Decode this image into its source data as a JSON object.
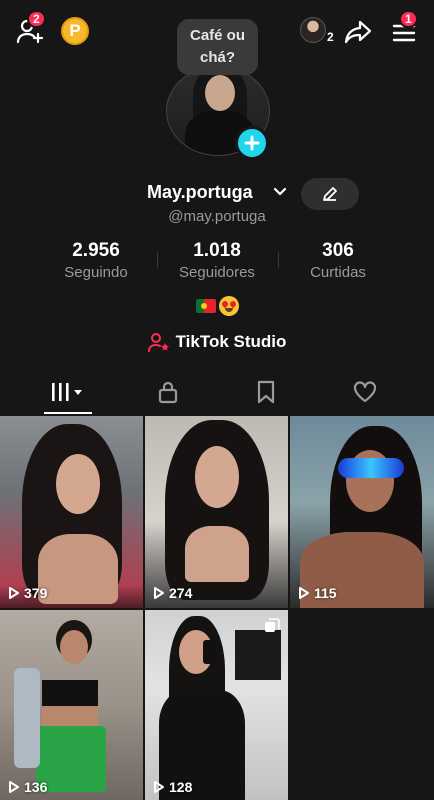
{
  "topbar": {
    "add_friends_badge": "2",
    "coin_label": "P",
    "nav_avatar_count": "2",
    "menu_badge": "1"
  },
  "note_bubble": {
    "line1": "Café ou",
    "line2": "chá?"
  },
  "profile": {
    "name": "May.portuga",
    "handle": "@may.portuga"
  },
  "stats": [
    {
      "value": "2.956",
      "label": "Seguindo"
    },
    {
      "value": "1.018",
      "label": "Seguidores"
    },
    {
      "value": "306",
      "label": "Curtidas"
    }
  ],
  "studio": {
    "label": "TikTok Studio"
  },
  "tabs": [
    {
      "icon": "grid-icon",
      "active": true
    },
    {
      "icon": "lock-icon",
      "active": false
    },
    {
      "icon": "bookmark-icon",
      "active": false
    },
    {
      "icon": "heart-icon",
      "active": false
    }
  ],
  "videos": [
    {
      "views": "379"
    },
    {
      "views": "274"
    },
    {
      "views": "115"
    },
    {
      "views": "136"
    },
    {
      "views": "128"
    }
  ],
  "colors": {
    "background": "#161616",
    "accent": "#fe2c55",
    "plus_button": "#20d5ec",
    "secondary_text": "#9a9a9a"
  }
}
